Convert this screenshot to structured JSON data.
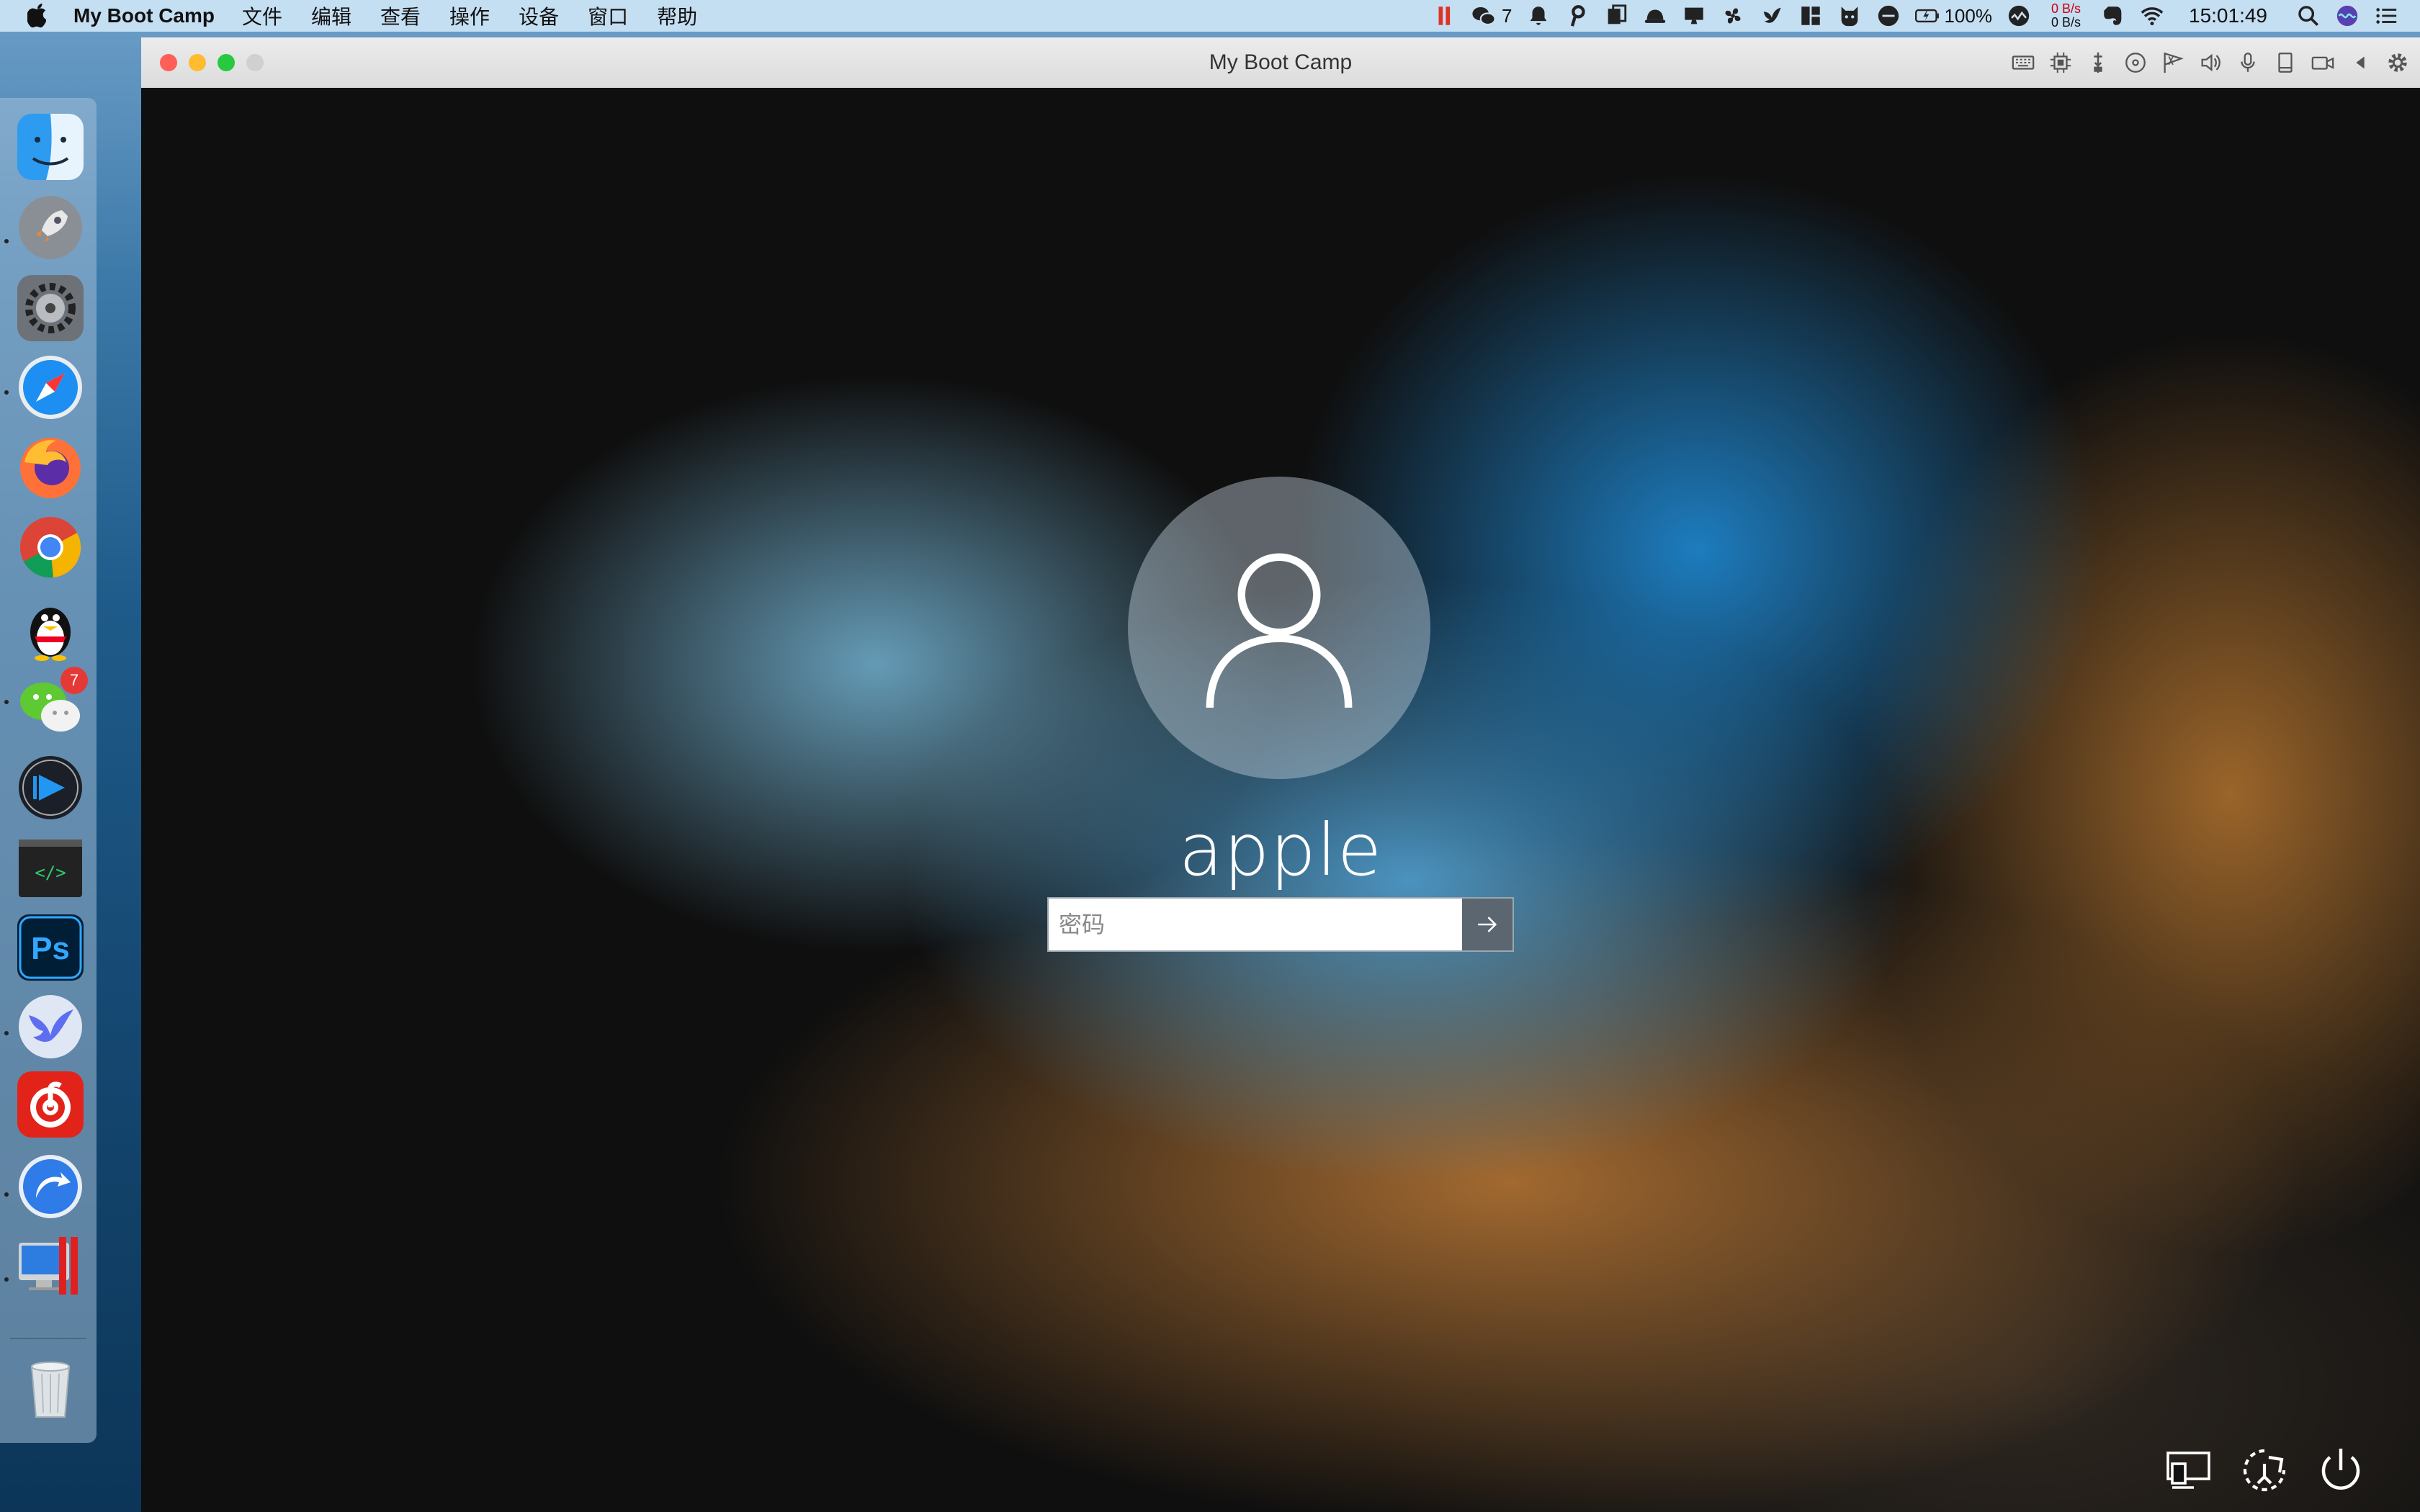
{
  "menubar": {
    "app_name": "My Boot Camp",
    "items": [
      "文件",
      "编辑",
      "查看",
      "操作",
      "设备",
      "窗口",
      "帮助"
    ],
    "wechat_count": "7",
    "battery": "100%",
    "net_up": "0 B/s",
    "net_down": "0 B/s",
    "clock": "15:01:49"
  },
  "dock": {
    "wechat_badge": "7"
  },
  "window": {
    "title": "My Boot Camp"
  },
  "login": {
    "username": "apple",
    "password_placeholder": "密码"
  },
  "colors": {
    "menubar_bg": "#c8e1f4",
    "close": "#fe5f57",
    "minimize": "#febc2e",
    "zoom": "#28c840",
    "submit_bg": "#5b6670"
  }
}
